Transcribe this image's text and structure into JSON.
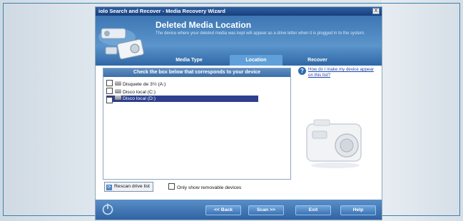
{
  "window": {
    "title": "iolo Search and Recover - Media Recovery Wizard",
    "close_glyph": "X"
  },
  "header": {
    "title": "Deleted Media Location",
    "description": "The device where your deleted media was kept will appear as a drive letter when it is plugged in to the system."
  },
  "tabs": [
    {
      "label": "Media Type",
      "active": false
    },
    {
      "label": "Location",
      "active": true
    },
    {
      "label": "Recover",
      "active": false
    }
  ],
  "panel": {
    "header": "Check the box below that corresponds to your device",
    "drives": [
      {
        "label": "Disquete de 3½ (A:)",
        "checked": false,
        "selected": false,
        "icon": "floppy-drive-icon"
      },
      {
        "label": "Disco local (C:)",
        "checked": false,
        "selected": false,
        "icon": "hard-drive-icon"
      },
      {
        "label": "Disco local (D:)",
        "checked": true,
        "selected": true,
        "icon": "hard-drive-icon"
      }
    ]
  },
  "help": {
    "glyph": "?",
    "link": "How do I make my device appear on this list?"
  },
  "controls": {
    "rescan_label": "Rescan drive list",
    "removable_label": "Only show removable devices",
    "removable_checked": false
  },
  "footer": {
    "back_label": "<< Back",
    "scan_label": "Scan >>",
    "exit_label": "Exit",
    "help_label": "Help"
  },
  "colors": {
    "title_bar": "#173e7c",
    "header_blue": "#3d76b3",
    "selected_row": "#2d3f8e",
    "link": "#1b43a8"
  }
}
